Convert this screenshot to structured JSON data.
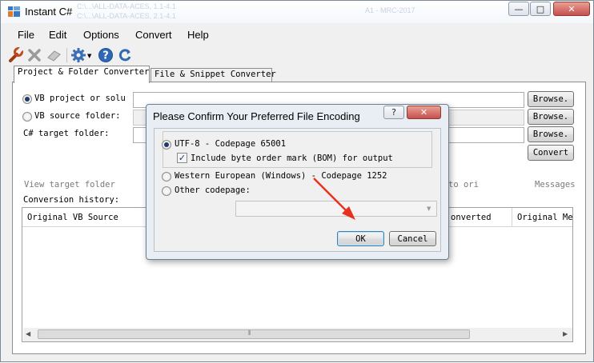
{
  "window": {
    "title": "Instant C#",
    "ghost_text": [
      "C:\\...\\ALL-DATA-ACES, 1.1-4.1",
      "C:\\...\\ALL-DATA-ACES, 2.1-4.1",
      "A1 - MRC-2017"
    ],
    "caption_buttons": {
      "minimize": "—",
      "maximize": "□",
      "close": "✕"
    }
  },
  "menu": {
    "items": [
      {
        "label": "File"
      },
      {
        "label": "Edit"
      },
      {
        "label": "Options"
      },
      {
        "label": "Convert"
      },
      {
        "label": "Help"
      }
    ]
  },
  "toolbar": {
    "icons": [
      "wrench-icon",
      "delete-x-icon",
      "eraser-icon",
      "gear-icon",
      "help-icon",
      "refresh-icon"
    ]
  },
  "tabs": [
    {
      "label": "Project & Folder Converter",
      "active": true
    },
    {
      "label": "File & Snippet Converter",
      "active": false
    }
  ],
  "form": {
    "vb_project_label": "VB project or solu",
    "vb_source_label": "VB source folder:",
    "cs_target_label": "C# target folder:",
    "browse_label": "Browse.",
    "convert_label": "Convert",
    "view_target_label": "View target folder",
    "to_ori_label": "to ori",
    "messages_label": "Messages",
    "history_label": "Conversion history:"
  },
  "history": {
    "columns": [
      "Original VB Source",
      "onverted",
      "Original Mes"
    ]
  },
  "dialog": {
    "title": "Please Confirm Your Preferred File Encoding",
    "help_button": "?",
    "close_button": "✕",
    "option_utf8": "UTF-8 - Codepage 65001",
    "option_bom": "Include byte order mark (BOM) for output",
    "bom_checked": true,
    "option_western": "Western European (Windows) - Codepage 1252",
    "option_other": "Other codepage:",
    "selected_option": "UTF-8 - Codepage 65001",
    "codepage_value": "",
    "ok_label": "OK",
    "cancel_label": "Cancel"
  },
  "colors": {
    "annotation_arrow": "#e8321f",
    "dialog_frame": "#e9eef5",
    "close_button": "#c75050"
  }
}
